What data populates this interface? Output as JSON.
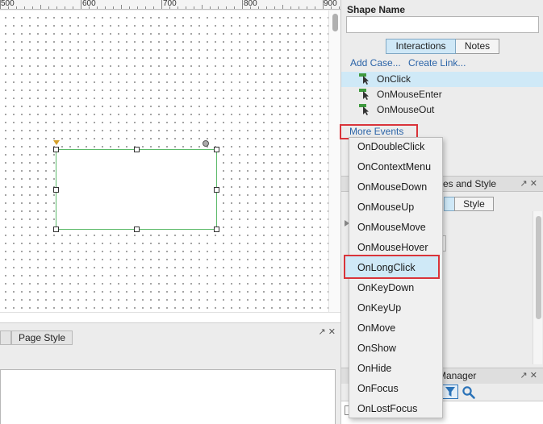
{
  "ruler": {
    "labels": [
      "500",
      "600",
      "700",
      "800",
      "900"
    ]
  },
  "bottom_panel": {
    "tab_page_style": "Page Style"
  },
  "right_panel": {
    "shape_name_label": "Shape Name",
    "shape_name_value": "",
    "tabs": {
      "interactions": "Interactions",
      "notes": "Notes"
    },
    "links": {
      "add_case": "Add Case...",
      "create_link": "Create Link..."
    },
    "events": [
      {
        "label": "OnClick",
        "selected": true
      },
      {
        "label": "OnMouseEnter",
        "selected": false
      },
      {
        "label": "OnMouseOut",
        "selected": false
      }
    ],
    "more_events": "More Events",
    "props_header": "ties and Style",
    "props_style_tab": "Style",
    "manager_header": "Manager"
  },
  "dropdown": {
    "items": [
      "OnDoubleClick",
      "OnContextMenu",
      "OnMouseDown",
      "OnMouseUp",
      "OnMouseMove",
      "OnMouseHover",
      "OnLongClick",
      "OnKeyDown",
      "OnKeyUp",
      "OnMove",
      "OnShow",
      "OnHide",
      "OnFocus",
      "OnLostFocus"
    ],
    "highlighted": "OnLongClick"
  },
  "icons": {
    "event": "event-cursor-icon",
    "popout": "popout-icon",
    "close": "close-icon",
    "filter": "filter-icon",
    "search": "search-icon"
  },
  "colors": {
    "accent_blue": "#2b64a8",
    "selection_bg": "#cfe9f7",
    "callout_red": "#d9343a",
    "shape_border": "#5cba6a",
    "event_icon_green": "#3f9a3f"
  }
}
